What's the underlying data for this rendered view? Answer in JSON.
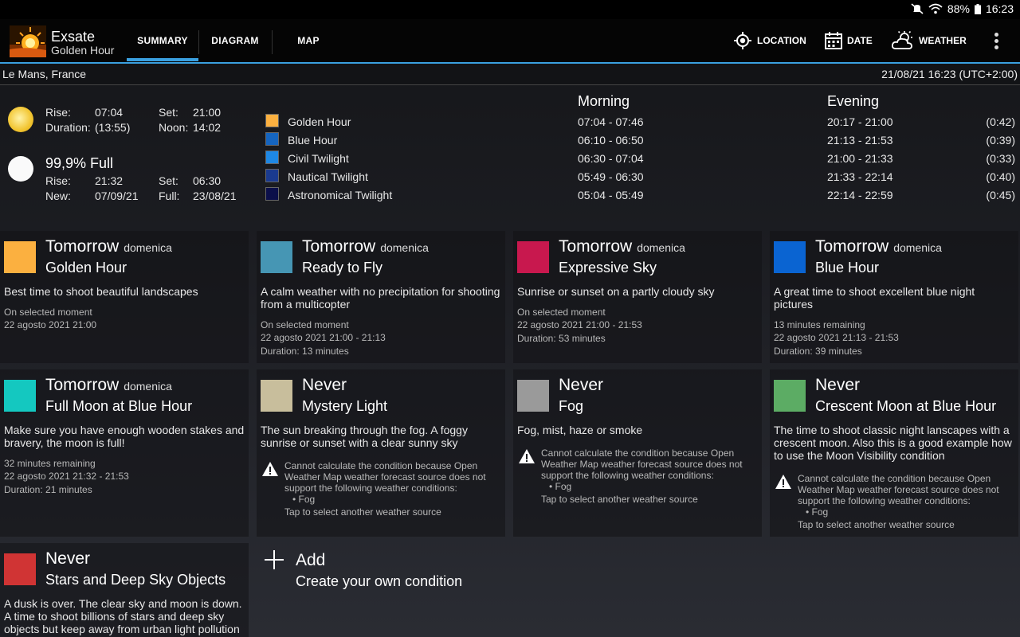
{
  "status": {
    "battery": "88%",
    "time": "16:23"
  },
  "app": {
    "title": "Exsate",
    "subtitle": "Golden Hour"
  },
  "tabs": [
    "SUMMARY",
    "DIAGRAM",
    "MAP"
  ],
  "actions": {
    "location": "LOCATION",
    "date": "DATE",
    "weather": "WEATHER"
  },
  "location": {
    "place": "Le Mans, France",
    "datetime": "21/08/21 16:23 (UTC+2:00)"
  },
  "sun": {
    "rise_label": "Rise:",
    "rise": "07:04",
    "set_label": "Set:",
    "set": "21:00",
    "duration_label": "Duration:",
    "duration": "(13:55)",
    "noon_label": "Noon:",
    "noon": "14:02"
  },
  "moon": {
    "phase": "99,9% Full",
    "rise_label": "Rise:",
    "rise": "21:32",
    "set_label": "Set:",
    "set": "06:30",
    "new_label": "New:",
    "new": "07/09/21",
    "full_label": "Full:",
    "full": "23/08/21"
  },
  "legend": [
    {
      "label": "Golden Hour",
      "color": "#fbb040"
    },
    {
      "label": "Blue Hour",
      "color": "#1565c0"
    },
    {
      "label": "Civil Twilight",
      "color": "#1e88e5"
    },
    {
      "label": "Nautical Twilight",
      "color": "#1a3a8f"
    },
    {
      "label": "Astronomical Twilight",
      "color": "#0b0f4a"
    }
  ],
  "times": {
    "morning_label": "Morning",
    "evening_label": "Evening",
    "morning": [
      "07:04 - 07:46",
      "06:10 - 06:50",
      "06:30 - 07:04",
      "05:49 - 06:30",
      "05:04 - 05:49"
    ],
    "evening": [
      "20:17 - 21:00",
      "21:13 - 21:53",
      "21:00 - 21:33",
      "21:33 - 22:14",
      "22:14 - 22:59"
    ],
    "durations": [
      "(0:42)",
      "(0:39)",
      "(0:33)",
      "(0:40)",
      "(0:45)"
    ]
  },
  "cards": [
    {
      "when": "Tomorrow",
      "day": "domenica",
      "name": "Golden Hour",
      "color": "#fbb040",
      "desc": "Best time to shoot beautiful landscapes",
      "meta": [
        "On selected moment",
        "22 agosto 2021 21:00"
      ]
    },
    {
      "when": "Tomorrow",
      "day": "domenica",
      "name": "Ready to Fly",
      "color": "#4696b4",
      "desc": "A calm weather with no precipitation for shooting from a multicopter",
      "meta": [
        "On selected moment",
        "22 agosto 2021 21:00 - 21:13",
        "Duration: 13 minutes"
      ]
    },
    {
      "when": "Tomorrow",
      "day": "domenica",
      "name": "Expressive Sky",
      "color": "#c8184e",
      "desc": "Sunrise or sunset on a partly cloudy sky",
      "meta": [
        "On selected moment",
        "22 agosto 2021 21:00 - 21:53",
        "Duration: 53 minutes"
      ]
    },
    {
      "when": "Tomorrow",
      "day": "domenica",
      "name": "Blue Hour",
      "color": "#0a64d2",
      "desc": "A great time to shoot excellent blue night pictures",
      "meta": [
        "13 minutes remaining",
        "22 agosto 2021 21:13 - 21:53",
        "Duration: 39 minutes"
      ]
    },
    {
      "when": "Tomorrow",
      "day": "domenica",
      "name": "Full Moon at Blue Hour",
      "color": "#14c8c0",
      "desc": "Make sure you have enough wooden stakes and bravery, the moon is full!",
      "meta": [
        "32 minutes remaining",
        "22 agosto 2021 21:32 - 21:53",
        "Duration: 21 minutes"
      ]
    },
    {
      "when": "Never",
      "day": "",
      "name": "Mystery Light",
      "color": "#c8be9c",
      "desc": "The sun breaking through the fog. A foggy sunrise or sunset with a clear sunny sky",
      "warning": "Cannot calculate the condition because Open Weather Map weather forecast source does not support the following weather conditions:",
      "bullet": "• Fog",
      "tap": "Tap to select another weather source"
    },
    {
      "when": "Never",
      "day": "",
      "name": "Fog",
      "color": "#9a9a9a",
      "desc": "Fog, mist, haze or smoke",
      "warning": "Cannot calculate the condition because Open Weather Map weather forecast source does not support the following weather conditions:",
      "bullet": "• Fog",
      "tap": "Tap to select another weather source"
    },
    {
      "when": "Never",
      "day": "",
      "name": "Crescent Moon at Blue Hour",
      "color": "#5cac64",
      "desc": "The time to shoot classic night lanscapes with a crescent moon. Also this is a good example how to use the Moon Visibility condition",
      "warning": "Cannot calculate the condition because Open Weather Map weather forecast source does not support the following weather conditions:",
      "bullet": "• Fog",
      "tap": "Tap to select another weather source"
    },
    {
      "when": "Never",
      "day": "",
      "name": "Stars and Deep Sky Objects",
      "color": "#d03434",
      "desc": "A dusk is over. The clear sky and moon is down. A time to shoot billions of stars and deep sky objects but keep away from urban light pollution"
    }
  ],
  "add": {
    "title": "Add",
    "subtitle": "Create your own condition"
  }
}
